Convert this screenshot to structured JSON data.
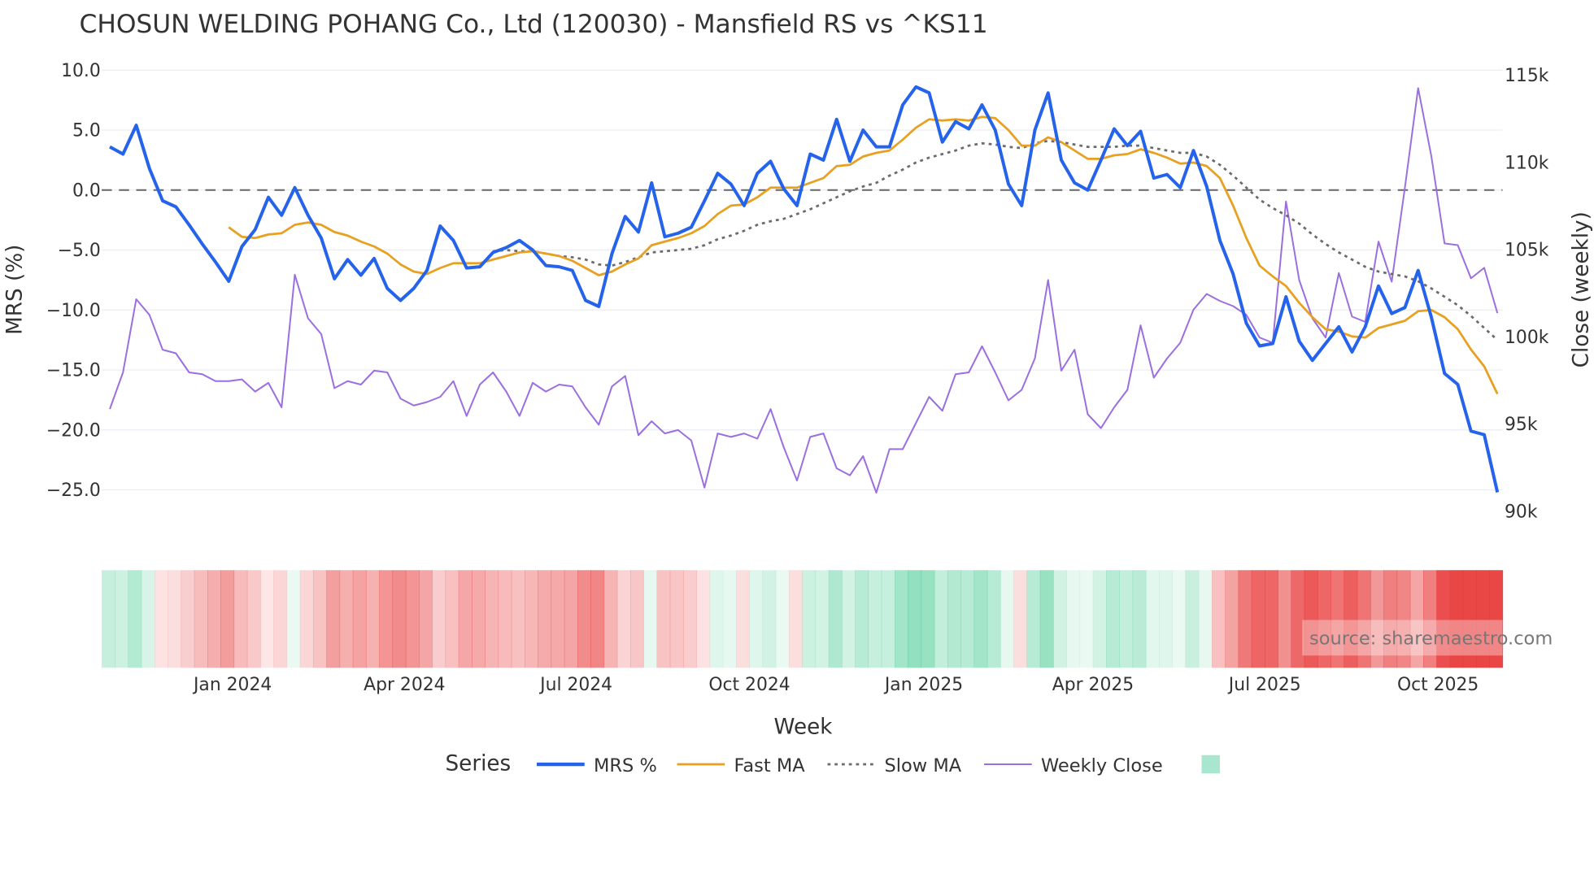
{
  "chart_data": {
    "type": "line",
    "title": "CHOSUN WELDING POHANG Co., Ltd (120030) - Mansfield RS vs ^KS11",
    "xlabel": "Week",
    "ylabel": "MRS (%)",
    "y2label": "Close (weekly)",
    "ylim": [
      -27.5,
      11.5
    ],
    "y2lim": [
      89,
      115.5
    ],
    "yticks": [
      "10.0",
      "5.0",
      "0.0",
      "−5.0",
      "−10.0",
      "−15.0",
      "−20.0",
      "−25.0"
    ],
    "ytick_values": [
      10,
      5,
      0,
      -5,
      -10,
      -15,
      -20,
      -25
    ],
    "y2ticks": [
      "115k",
      "110k",
      "105k",
      "100k",
      "95k",
      "90k"
    ],
    "y2tick_values": [
      115,
      110,
      105,
      100,
      95,
      90
    ],
    "xticks": [
      "Jan 2024",
      "Apr 2024",
      "Jul 2024",
      "Oct 2024",
      "Jan 2025",
      "Apr 2025",
      "Jul 2025",
      "Oct 2025"
    ],
    "xtick_week_index": [
      9.3,
      22.3,
      35.3,
      48.4,
      61.6,
      74.4,
      87.4,
      100.5
    ],
    "reference_line": 0,
    "legend_title": "Series",
    "series": [
      {
        "name": "MRS %",
        "color": "#2563eb",
        "axis": "left",
        "values": [
          3.6,
          3.0,
          5.4,
          1.8,
          -0.9,
          -1.4,
          -2.9,
          -4.5,
          -6.0,
          -7.6,
          -4.7,
          -3.3,
          -0.6,
          -2.1,
          0.2,
          -2.1,
          -4.0,
          -7.4,
          -5.8,
          -7.1,
          -5.7,
          -8.2,
          -9.2,
          -8.2,
          -6.7,
          -3.0,
          -4.2,
          -6.5,
          -6.4,
          -5.2,
          -4.8,
          -4.2,
          -5.0,
          -6.3,
          -6.4,
          -6.7,
          -9.2,
          -9.7,
          -5.3,
          -2.2,
          -3.5,
          0.6,
          -3.9,
          -3.6,
          -3.1,
          -0.9,
          1.4,
          0.5,
          -1.3,
          1.4,
          2.4,
          0.1,
          -1.3,
          3.0,
          2.5,
          5.9,
          2.4,
          5.0,
          3.6,
          3.6,
          7.1,
          8.6,
          8.1,
          4.0,
          5.7,
          5.1,
          7.1,
          5.0,
          0.5,
          -1.3,
          5.0,
          8.1,
          2.5,
          0.6,
          0.0,
          2.5,
          5.1,
          3.7,
          4.9,
          1.0,
          1.3,
          0.2,
          3.3,
          0.3,
          -4.2,
          -7.0,
          -11.1,
          -13.0,
          -12.8,
          -8.9,
          -12.6,
          -14.2,
          -12.8,
          -11.4,
          -13.5,
          -11.4,
          -8.0,
          -10.3,
          -9.8,
          -6.7,
          -10.6,
          -15.3,
          -16.2,
          -20.1,
          -20.4,
          -25.2
        ]
      },
      {
        "name": "Fast MA",
        "color": "#e8a020",
        "axis": "left",
        "values": [
          -3.1,
          -3.9,
          -4.0,
          -3.7,
          -3.6,
          -2.9,
          -2.7,
          -2.9,
          -3.5,
          -3.8,
          -4.3,
          -4.7,
          -5.3,
          -6.2,
          -6.8,
          -7.0,
          -6.5,
          -6.1,
          -6.1,
          -6.1,
          -5.8,
          -5.5,
          -5.2,
          -5.1,
          -5.3,
          -5.5,
          -5.9,
          -6.5,
          -7.1,
          -6.8,
          -6.2,
          -5.7,
          -4.6,
          -4.3,
          -4.0,
          -3.6,
          -3.0,
          -2.0,
          -1.3,
          -1.2,
          -0.6,
          0.2,
          0.2,
          0.2,
          0.6,
          1.0,
          2.0,
          2.1,
          2.8,
          3.1,
          3.3,
          4.2,
          5.2,
          5.9,
          5.8,
          5.9,
          5.8,
          6.1,
          6.0,
          5.0,
          3.7,
          3.7,
          4.4,
          4.0,
          3.3,
          2.6,
          2.6,
          2.9,
          3.0,
          3.4,
          3.1,
          2.7,
          2.2,
          2.3,
          2.0,
          1.0,
          -1.3,
          -4.0,
          -6.3,
          -7.2,
          -8.0,
          -9.4,
          -10.6,
          -11.6,
          -11.8,
          -12.2,
          -12.3,
          -11.5,
          -11.2,
          -10.9,
          -10.1,
          -10.0,
          -10.6,
          -11.6,
          -13.3,
          -14.7,
          -17.0
        ]
      },
      {
        "name": "Slow MA",
        "color": "#6b6b6b",
        "axis": "left",
        "dash": "dot",
        "values": [
          -5.1,
          -5.0,
          -5.1,
          -5.1,
          -5.3,
          -5.5,
          -5.6,
          -5.8,
          -6.2,
          -6.3,
          -6.0,
          -5.6,
          -5.2,
          -5.1,
          -5.0,
          -4.9,
          -4.6,
          -4.1,
          -3.8,
          -3.4,
          -2.9,
          -2.6,
          -2.4,
          -2.0,
          -1.6,
          -1.1,
          -0.6,
          -0.1,
          0.3,
          0.6,
          1.2,
          1.7,
          2.3,
          2.7,
          3.0,
          3.3,
          3.7,
          3.9,
          3.8,
          3.6,
          3.5,
          3.9,
          4.1,
          4.0,
          3.8,
          3.6,
          3.6,
          3.6,
          3.7,
          3.7,
          3.5,
          3.3,
          3.1,
          3.1,
          2.8,
          2.1,
          1.2,
          0.2,
          -0.8,
          -1.5,
          -2.1,
          -2.8,
          -3.7,
          -4.5,
          -5.2,
          -5.8,
          -6.4,
          -6.8,
          -7.0,
          -7.2,
          -7.6,
          -8.2,
          -8.9,
          -9.6,
          -10.5,
          -11.5,
          -12.5
        ]
      },
      {
        "name": "Weekly Close",
        "color": "#9b6fe0",
        "axis": "right",
        "unit": "k",
        "values": [
          95.8,
          97.9,
          102.1,
          101.2,
          99.2,
          99.0,
          97.9,
          97.8,
          97.4,
          97.4,
          97.5,
          96.8,
          97.3,
          95.9,
          103.5,
          101.0,
          100.1,
          97.0,
          97.4,
          97.2,
          98.0,
          97.9,
          96.4,
          96.0,
          96.2,
          96.5,
          97.4,
          95.4,
          97.2,
          97.9,
          96.8,
          95.4,
          97.3,
          96.8,
          97.2,
          97.1,
          95.9,
          94.9,
          97.1,
          97.7,
          94.3,
          95.1,
          94.4,
          94.6,
          94.0,
          91.3,
          94.4,
          94.2,
          94.4,
          94.1,
          95.8,
          93.6,
          91.7,
          94.2,
          94.4,
          92.4,
          92.0,
          93.1,
          91.0,
          93.5,
          93.5,
          95.0,
          96.5,
          95.7,
          97.8,
          97.9,
          99.4,
          97.9,
          96.3,
          96.9,
          98.7,
          103.2,
          98.0,
          99.2,
          95.5,
          94.7,
          95.9,
          96.9,
          100.6,
          97.6,
          98.7,
          99.6,
          101.5,
          102.4,
          102.0,
          101.7,
          101.2,
          99.9,
          99.6,
          107.7,
          103.2,
          101.0,
          99.9,
          103.6,
          101.1,
          100.8,
          105.4,
          103.1,
          108.5,
          114.2,
          110.3,
          105.3,
          105.2,
          103.3,
          103.9,
          101.3
        ]
      }
    ],
    "heatmap": {
      "source_series": "MRS %",
      "positive_color": "#3cc88c",
      "negative_color": "#e83c3c",
      "legend_color": "#a8e6cf"
    },
    "source_label": "source: sharemaestro.com"
  }
}
